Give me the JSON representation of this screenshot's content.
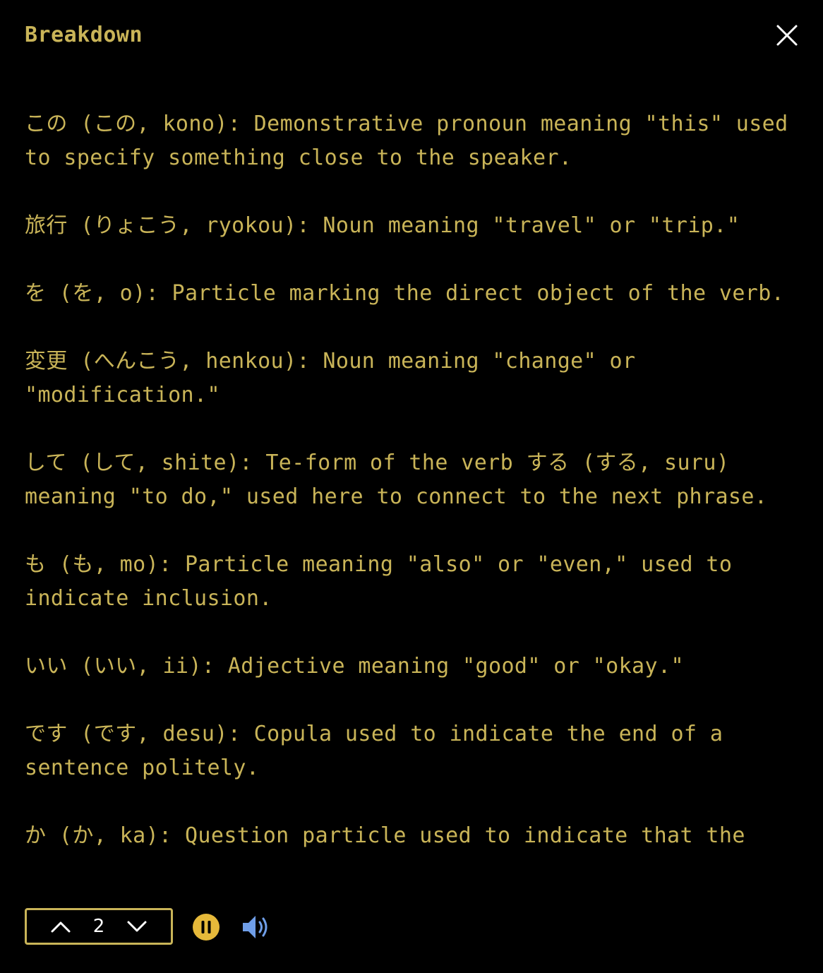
{
  "header": {
    "title": "Breakdown",
    "close_icon": "close-icon"
  },
  "entries": [
    "この (この, kono): Demonstrative pronoun meaning \"this\" used to specify something close to the speaker.",
    "旅行 (りょこう, ryokou): Noun meaning \"travel\" or \"trip.\"",
    "を (を, o): Particle marking the direct object of the verb.",
    "変更 (へんこう, henkou): Noun meaning \"change\" or \"modification.\"",
    "して (して, shite): Te-form of the verb する (する, suru) meaning \"to do,\" used here to connect to the next phrase.",
    "も (も, mo): Particle meaning \"also\" or \"even,\" used to indicate inclusion.",
    "いい (いい, ii): Adjective meaning \"good\" or \"okay.\"",
    "です (です, desu): Copula used to indicate the end of a sentence politely.",
    "か (か, ka): Question particle used to indicate that the"
  ],
  "footer": {
    "stepper_value": "2",
    "up_icon": "chevron-up-icon",
    "down_icon": "chevron-down-icon",
    "pause_icon": "pause-icon",
    "speaker_icon": "speaker-icon"
  },
  "colors": {
    "background": "#000000",
    "text": "#c9b458",
    "accent": "#e6b93a",
    "speaker": "#6f9ee8"
  }
}
